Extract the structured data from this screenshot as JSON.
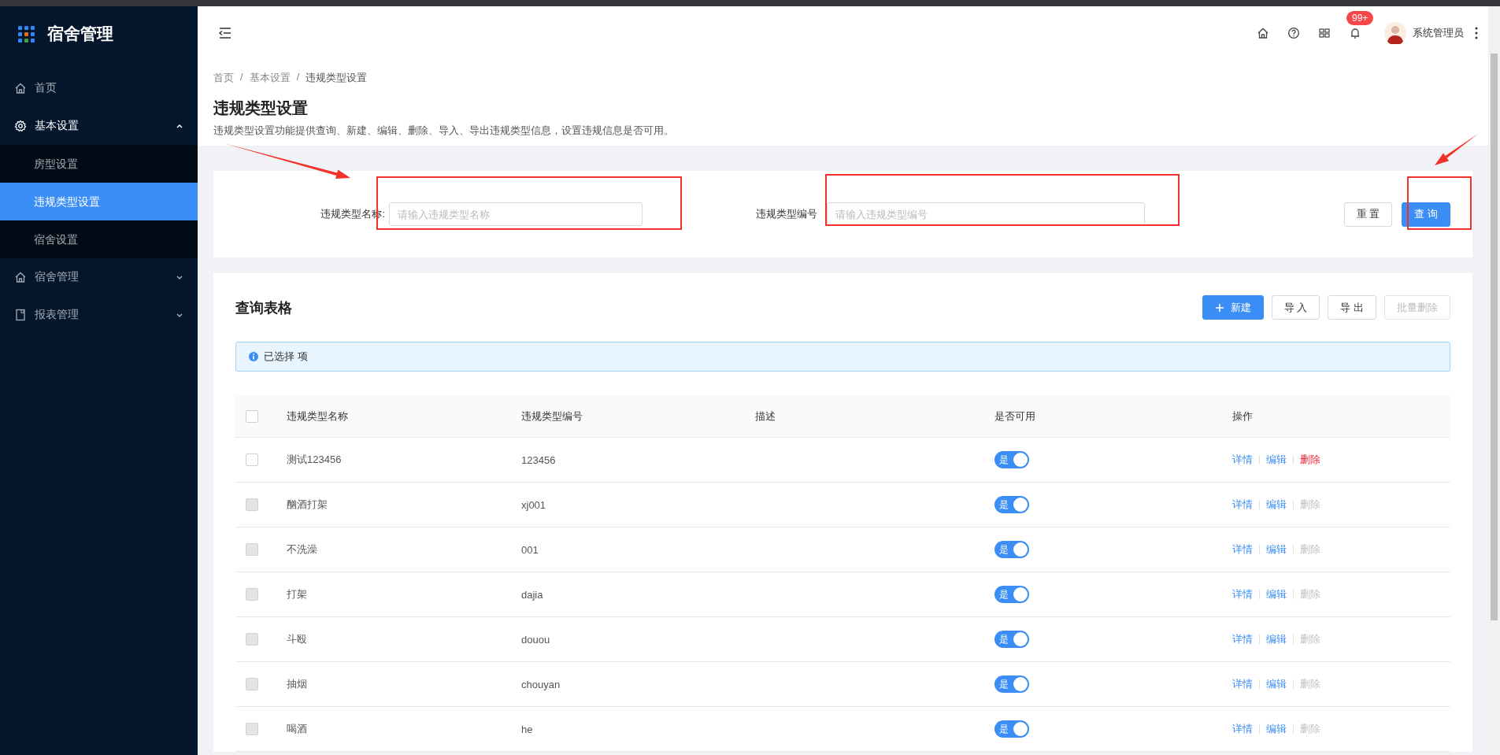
{
  "sidebar": {
    "title": "宿舍管理",
    "items": [
      {
        "label": "首页",
        "selected": false
      },
      {
        "label": "基本设置",
        "expanded": true,
        "selected": false,
        "children": [
          {
            "label": "房型设置",
            "selected": false
          },
          {
            "label": "违规类型设置",
            "selected": true
          },
          {
            "label": "宿舍设置",
            "selected": false
          }
        ]
      },
      {
        "label": "宿舍管理",
        "expanded": false,
        "selected": false
      },
      {
        "label": "报表管理",
        "expanded": false,
        "selected": false
      }
    ]
  },
  "header": {
    "notification_count": "99+",
    "user": "系统管理员"
  },
  "breadcrumb": {
    "separator": "/",
    "items": [
      "首页",
      "基本设置",
      "违规类型设置"
    ]
  },
  "page": {
    "title": "违规类型设置",
    "description": "违规类型设置功能提供查询、新建、编辑、删除、导入、导出违规类型信息，设置违规信息是否可用。"
  },
  "filters": [
    {
      "label": "违规类型名称:",
      "placeholder": "请输入违规类型名称"
    },
    {
      "label": "违规类型编号",
      "placeholder": "请输入违规类型编号"
    }
  ],
  "filter_buttons": [
    {
      "label": "重 置",
      "kind": "default"
    },
    {
      "label": "查 询",
      "kind": "primary"
    }
  ],
  "table": {
    "title": "查询表格",
    "buttons": [
      {
        "label": "新建",
        "kind": "primary",
        "disabled": false
      },
      {
        "label": "导 入",
        "kind": "default",
        "disabled": false
      },
      {
        "label": "导 出",
        "kind": "default",
        "disabled": false
      },
      {
        "label": "批量删除",
        "kind": "default",
        "disabled": true
      }
    ],
    "alert": "已选择 项",
    "select_all": {
      "checked": false
    },
    "columns": [
      "违规类型名称",
      "违规类型编号",
      "描述",
      "是否可用",
      "操作"
    ],
    "rows": [
      {
        "name": "测试123456",
        "code": "123456",
        "checkbox_disabled": false,
        "enabled": {
          "on": true,
          "label": "是"
        },
        "actions": [
          {
            "label": "详情",
            "kind": "link",
            "disabled": false
          },
          {
            "label": "编辑",
            "kind": "link",
            "disabled": false
          },
          {
            "label": "删除",
            "kind": "danger",
            "disabled": false
          }
        ]
      },
      {
        "name": "酗酒打架",
        "code": "xj001",
        "checkbox_disabled": true,
        "enabled": {
          "on": true,
          "label": "是"
        },
        "actions": [
          {
            "label": "详情",
            "kind": "link",
            "disabled": false
          },
          {
            "label": "编辑",
            "kind": "link",
            "disabled": false
          },
          {
            "label": "删除",
            "kind": "danger",
            "disabled": true
          }
        ]
      },
      {
        "name": "不洗澡",
        "code": "001",
        "checkbox_disabled": true,
        "enabled": {
          "on": true,
          "label": "是"
        },
        "actions": [
          {
            "label": "详情",
            "kind": "link",
            "disabled": false
          },
          {
            "label": "编辑",
            "kind": "link",
            "disabled": false
          },
          {
            "label": "删除",
            "kind": "danger",
            "disabled": true
          }
        ]
      },
      {
        "name": "打架",
        "code": "dajia",
        "checkbox_disabled": true,
        "enabled": {
          "on": true,
          "label": "是"
        },
        "actions": [
          {
            "label": "详情",
            "kind": "link",
            "disabled": false
          },
          {
            "label": "编辑",
            "kind": "link",
            "disabled": false
          },
          {
            "label": "删除",
            "kind": "danger",
            "disabled": true
          }
        ]
      },
      {
        "name": "斗殴",
        "code": "douou",
        "checkbox_disabled": true,
        "enabled": {
          "on": true,
          "label": "是"
        },
        "actions": [
          {
            "label": "详情",
            "kind": "link",
            "disabled": false
          },
          {
            "label": "编辑",
            "kind": "link",
            "disabled": false
          },
          {
            "label": "删除",
            "kind": "danger",
            "disabled": true
          }
        ]
      },
      {
        "name": "抽烟",
        "code": "chouyan",
        "checkbox_disabled": true,
        "enabled": {
          "on": true,
          "label": "是"
        },
        "actions": [
          {
            "label": "详情",
            "kind": "link",
            "disabled": false
          },
          {
            "label": "编辑",
            "kind": "link",
            "disabled": false
          },
          {
            "label": "删除",
            "kind": "danger",
            "disabled": true
          }
        ]
      },
      {
        "name": "喝酒",
        "code": "he",
        "checkbox_disabled": true,
        "enabled": {
          "on": true,
          "label": "是"
        },
        "actions": [
          {
            "label": "详情",
            "kind": "link",
            "disabled": false
          },
          {
            "label": "编辑",
            "kind": "link",
            "disabled": false
          },
          {
            "label": "删除",
            "kind": "danger",
            "disabled": true
          }
        ]
      }
    ]
  },
  "annotations": [
    {
      "kind": "arrow"
    },
    {
      "kind": "box"
    },
    {
      "kind": "box"
    },
    {
      "kind": "arrow"
    },
    {
      "kind": "box"
    }
  ]
}
